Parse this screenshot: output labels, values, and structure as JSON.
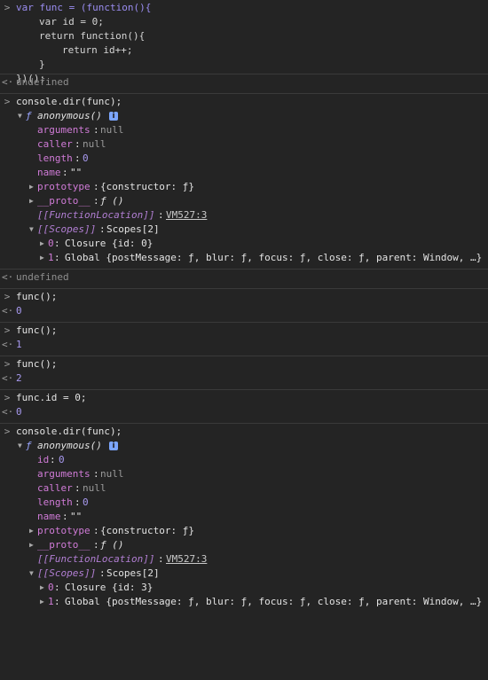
{
  "prompt_glyph": ">",
  "result_glyph": "<·",
  "entries": {
    "e1": {
      "l1": "var func = (function(){",
      "l2": "var id = 0;",
      "l3": "return function(){",
      "l4": "return id++;",
      "l5": "}",
      "l6": "})();"
    },
    "undefined_text": "undefined",
    "cmd_dir": "console.dir(func);",
    "dir1": {
      "head": "anonymous()",
      "fsym": "ƒ",
      "info": "i",
      "arguments_k": "arguments",
      "arguments_v": "null",
      "caller_k": "caller",
      "caller_v": "null",
      "length_k": "length",
      "length_v": "0",
      "name_k": "name",
      "name_v": "\"\"",
      "prototype_k": "prototype",
      "prototype_v": "{constructor: ƒ}",
      "proto_k": "__proto__",
      "proto_v": "ƒ ()",
      "loc_k": "[[FunctionLocation]]",
      "loc_v": "VM527:3",
      "scopes_k": "[[Scopes]]",
      "scopes_v": "Scopes[2]",
      "s0_k": "0",
      "s0_v": "Closure {id: 0}",
      "s1_k": "1",
      "s1_v": "Global {postMessage: ƒ, blur: ƒ, focus: ƒ, close: ƒ, parent: Window, …}"
    },
    "call_func": "func();",
    "r0": "0",
    "r1": "1",
    "r2": "2",
    "assign": "func.id = 0;",
    "assign_result": "0",
    "dir2": {
      "id_k": "id",
      "id_v": "0",
      "s0_v": "Closure {id: 3}"
    }
  }
}
